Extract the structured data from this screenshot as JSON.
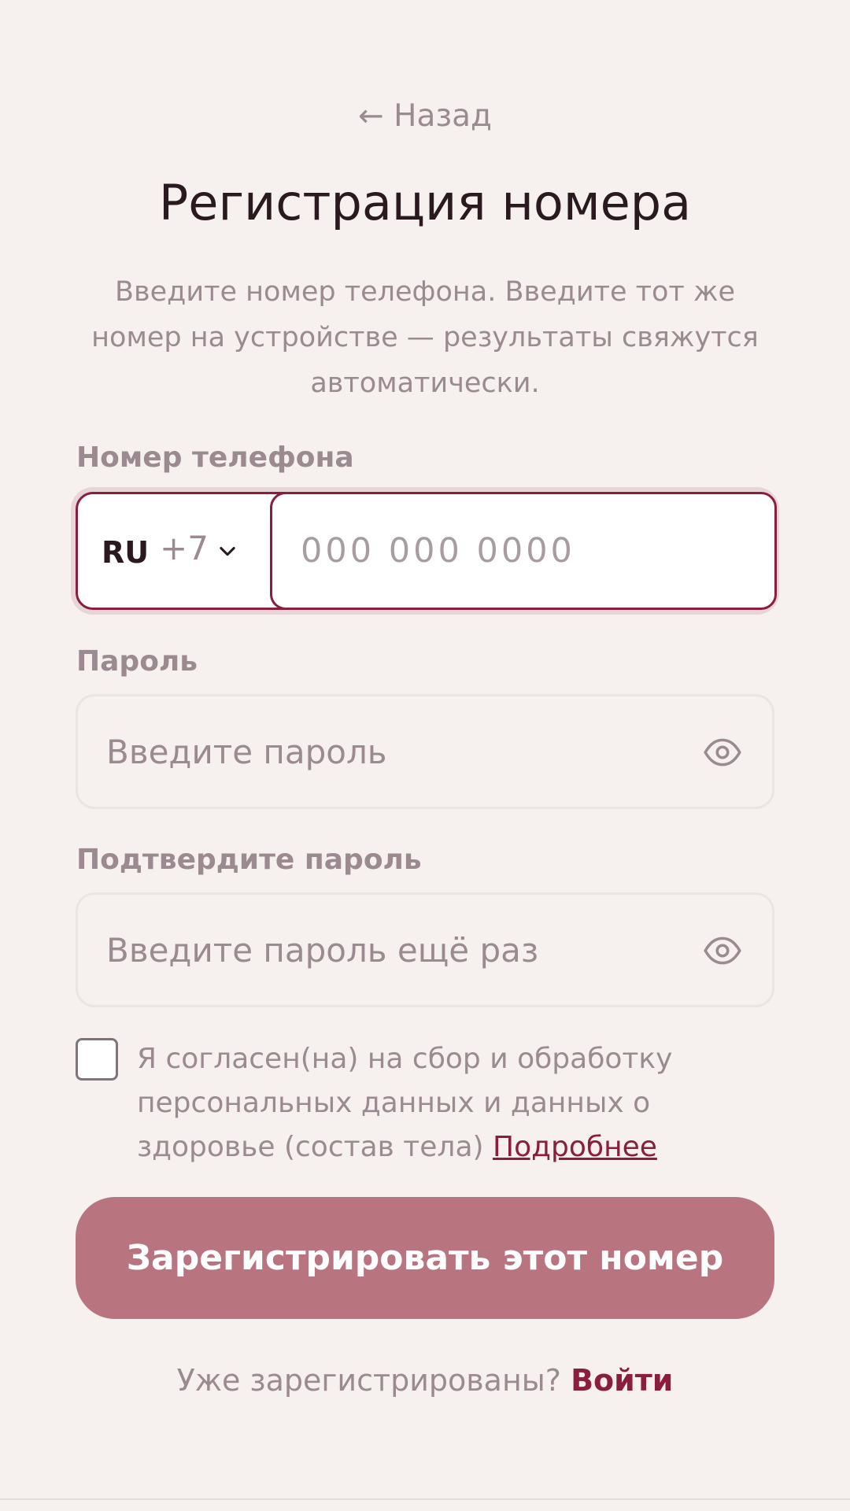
{
  "nav": {
    "back_label": "← Назад"
  },
  "header": {
    "title": "Регистрация номера",
    "subtitle": "Введите номер телефона. Введите тот же номер на устройстве — результаты свяжутся автоматически."
  },
  "phone": {
    "label": "Номер телефона",
    "country_code": "RU",
    "dial_code": "+7",
    "placeholder": "000 000 0000",
    "value": ""
  },
  "password": {
    "label": "Пароль",
    "placeholder": "Введите пароль",
    "value": "",
    "toggle_icon": "eye-icon"
  },
  "confirm_password": {
    "label": "Подтвердите пароль",
    "placeholder": "Введите пароль ещё раз",
    "value": "",
    "toggle_icon": "eye-icon"
  },
  "consent": {
    "checked": false,
    "text": "Я согласен(на) на сбор и обработку персональных данных и данных о здоровье (состав тела)",
    "link_label": "Подробнее"
  },
  "submit": {
    "label": "Зарегистрировать этот номер"
  },
  "footer": {
    "prompt": "Уже зарегистрированы?",
    "login_label": "Войти"
  },
  "colors": {
    "background": "#f6f1ef",
    "accent": "#8b1e3f",
    "button": "#b87580",
    "muted_text": "#9b8a90",
    "title_text": "#2a1a1f"
  }
}
